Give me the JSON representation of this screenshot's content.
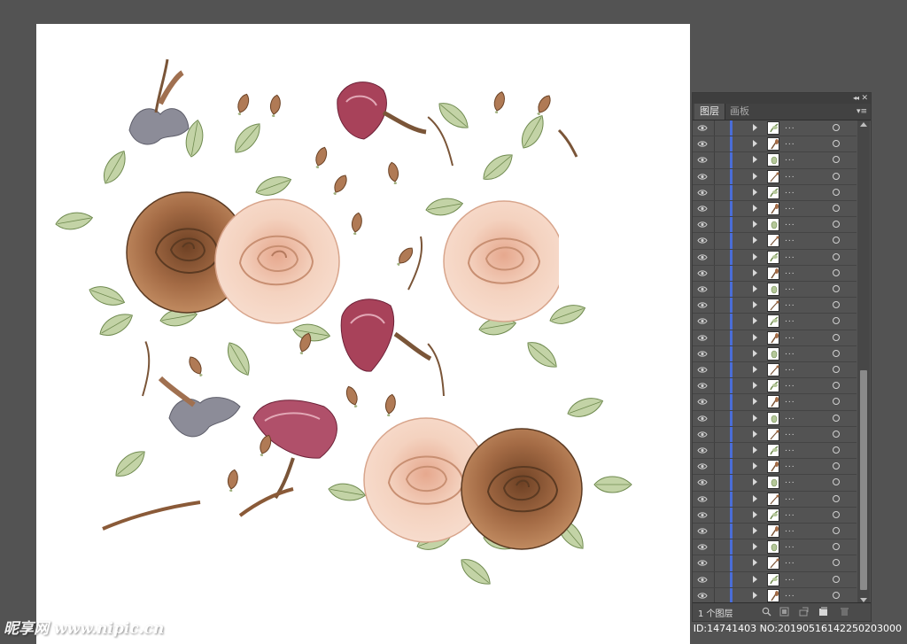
{
  "panel": {
    "collapse_glyph": "◂◂",
    "close_glyph": "✕",
    "tabs": [
      {
        "label": "图层",
        "active": true
      },
      {
        "label": "画板",
        "active": false
      }
    ],
    "menu_glyph": "▾≡",
    "layer_name": "...",
    "row_count": 30,
    "footer": {
      "count_label": "1 个图层",
      "icons": [
        "locate-object-icon",
        "make-clipping-mask-icon",
        "new-sublayer-icon",
        "new-layer-icon",
        "delete-icon"
      ]
    }
  },
  "watermark": {
    "site": "昵享网 www.nipic.cn",
    "id_text": "ID:14741403 NO:20190516142250203000"
  },
  "colors": {
    "workspace": "#535353",
    "layer_color": "#4a6dd8",
    "rose_pink": "#f2c9b3",
    "rose_brown": "#a46b45",
    "carnation": "#a8425a",
    "leaf": "#b5c89a",
    "lily_gray": "#8c8c98"
  }
}
